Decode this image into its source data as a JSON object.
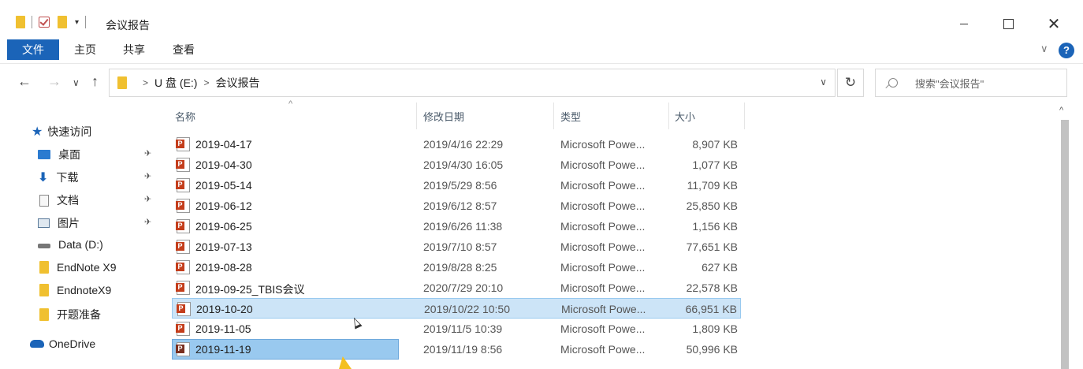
{
  "window": {
    "title": "会议报告",
    "close_glyph": "✕"
  },
  "ribbon": {
    "tabs": [
      "文件",
      "主页",
      "共享",
      "查看"
    ],
    "help": "?",
    "collapse_glyph": "∨"
  },
  "address": {
    "back_glyph": "←",
    "forward_glyph": "→",
    "recent_glyph": "∨",
    "up_glyph": "↑",
    "crumb_sep": ">",
    "crumbs": [
      "U 盘 (E:)",
      "会议报告"
    ],
    "dropdown_glyph": "∨",
    "refresh_glyph": "↻"
  },
  "search": {
    "placeholder": "搜索\"会议报告\""
  },
  "nav_pane": {
    "quick_access": "快速访问",
    "items": [
      {
        "label": "桌面",
        "icon": "desktop-icon",
        "pinned": true
      },
      {
        "label": "下载",
        "icon": "download-icon",
        "pinned": true
      },
      {
        "label": "文档",
        "icon": "document-icon",
        "pinned": true
      },
      {
        "label": "图片",
        "icon": "pictures-icon",
        "pinned": true
      },
      {
        "label": "Data (D:)",
        "icon": "drive-icon",
        "pinned": false
      },
      {
        "label": "EndNote X9",
        "icon": "folder-icon",
        "pinned": false
      },
      {
        "label": "EndnoteX9",
        "icon": "folder-icon",
        "pinned": false
      },
      {
        "label": "开题准备",
        "icon": "folder-icon",
        "pinned": false
      }
    ],
    "onedrive": "OneDrive",
    "pin_glyph": "✈"
  },
  "columns": {
    "name": "名称",
    "modified": "修改日期",
    "type": "类型",
    "size": "大小",
    "sort_glyph": "^"
  },
  "files": [
    {
      "name": "2019-04-17",
      "modified": "2019/4/16 22:29",
      "type": "Microsoft Powe...",
      "size": "8,907 KB",
      "state": "normal"
    },
    {
      "name": "2019-04-30",
      "modified": "2019/4/30 16:05",
      "type": "Microsoft Powe...",
      "size": "1,077 KB",
      "state": "normal"
    },
    {
      "name": "2019-05-14",
      "modified": "2019/5/29 8:56",
      "type": "Microsoft Powe...",
      "size": "11,709 KB",
      "state": "normal"
    },
    {
      "name": "2019-06-12",
      "modified": "2019/6/12 8:57",
      "type": "Microsoft Powe...",
      "size": "25,850 KB",
      "state": "normal"
    },
    {
      "name": "2019-06-25",
      "modified": "2019/6/26 11:38",
      "type": "Microsoft Powe...",
      "size": "1,156 KB",
      "state": "normal"
    },
    {
      "name": "2019-07-13",
      "modified": "2019/7/10 8:57",
      "type": "Microsoft Powe...",
      "size": "77,651 KB",
      "state": "normal"
    },
    {
      "name": "2019-08-28",
      "modified": "2019/8/28 8:25",
      "type": "Microsoft Powe...",
      "size": "627 KB",
      "state": "normal"
    },
    {
      "name": "2019-09-25_TBIS会议",
      "modified": "2020/7/29 20:10",
      "type": "Microsoft Powe...",
      "size": "22,578 KB",
      "state": "normal"
    },
    {
      "name": "2019-10-20",
      "modified": "2019/10/22 10:50",
      "type": "Microsoft Powe...",
      "size": "66,951 KB",
      "state": "hover"
    },
    {
      "name": "2019-11-05",
      "modified": "2019/11/5 10:39",
      "type": "Microsoft Powe...",
      "size": "1,809 KB",
      "state": "normal"
    },
    {
      "name": "2019-11-19",
      "modified": "2019/11/19 8:56",
      "type": "Microsoft Powe...",
      "size": "50,996 KB",
      "state": "renaming"
    }
  ]
}
